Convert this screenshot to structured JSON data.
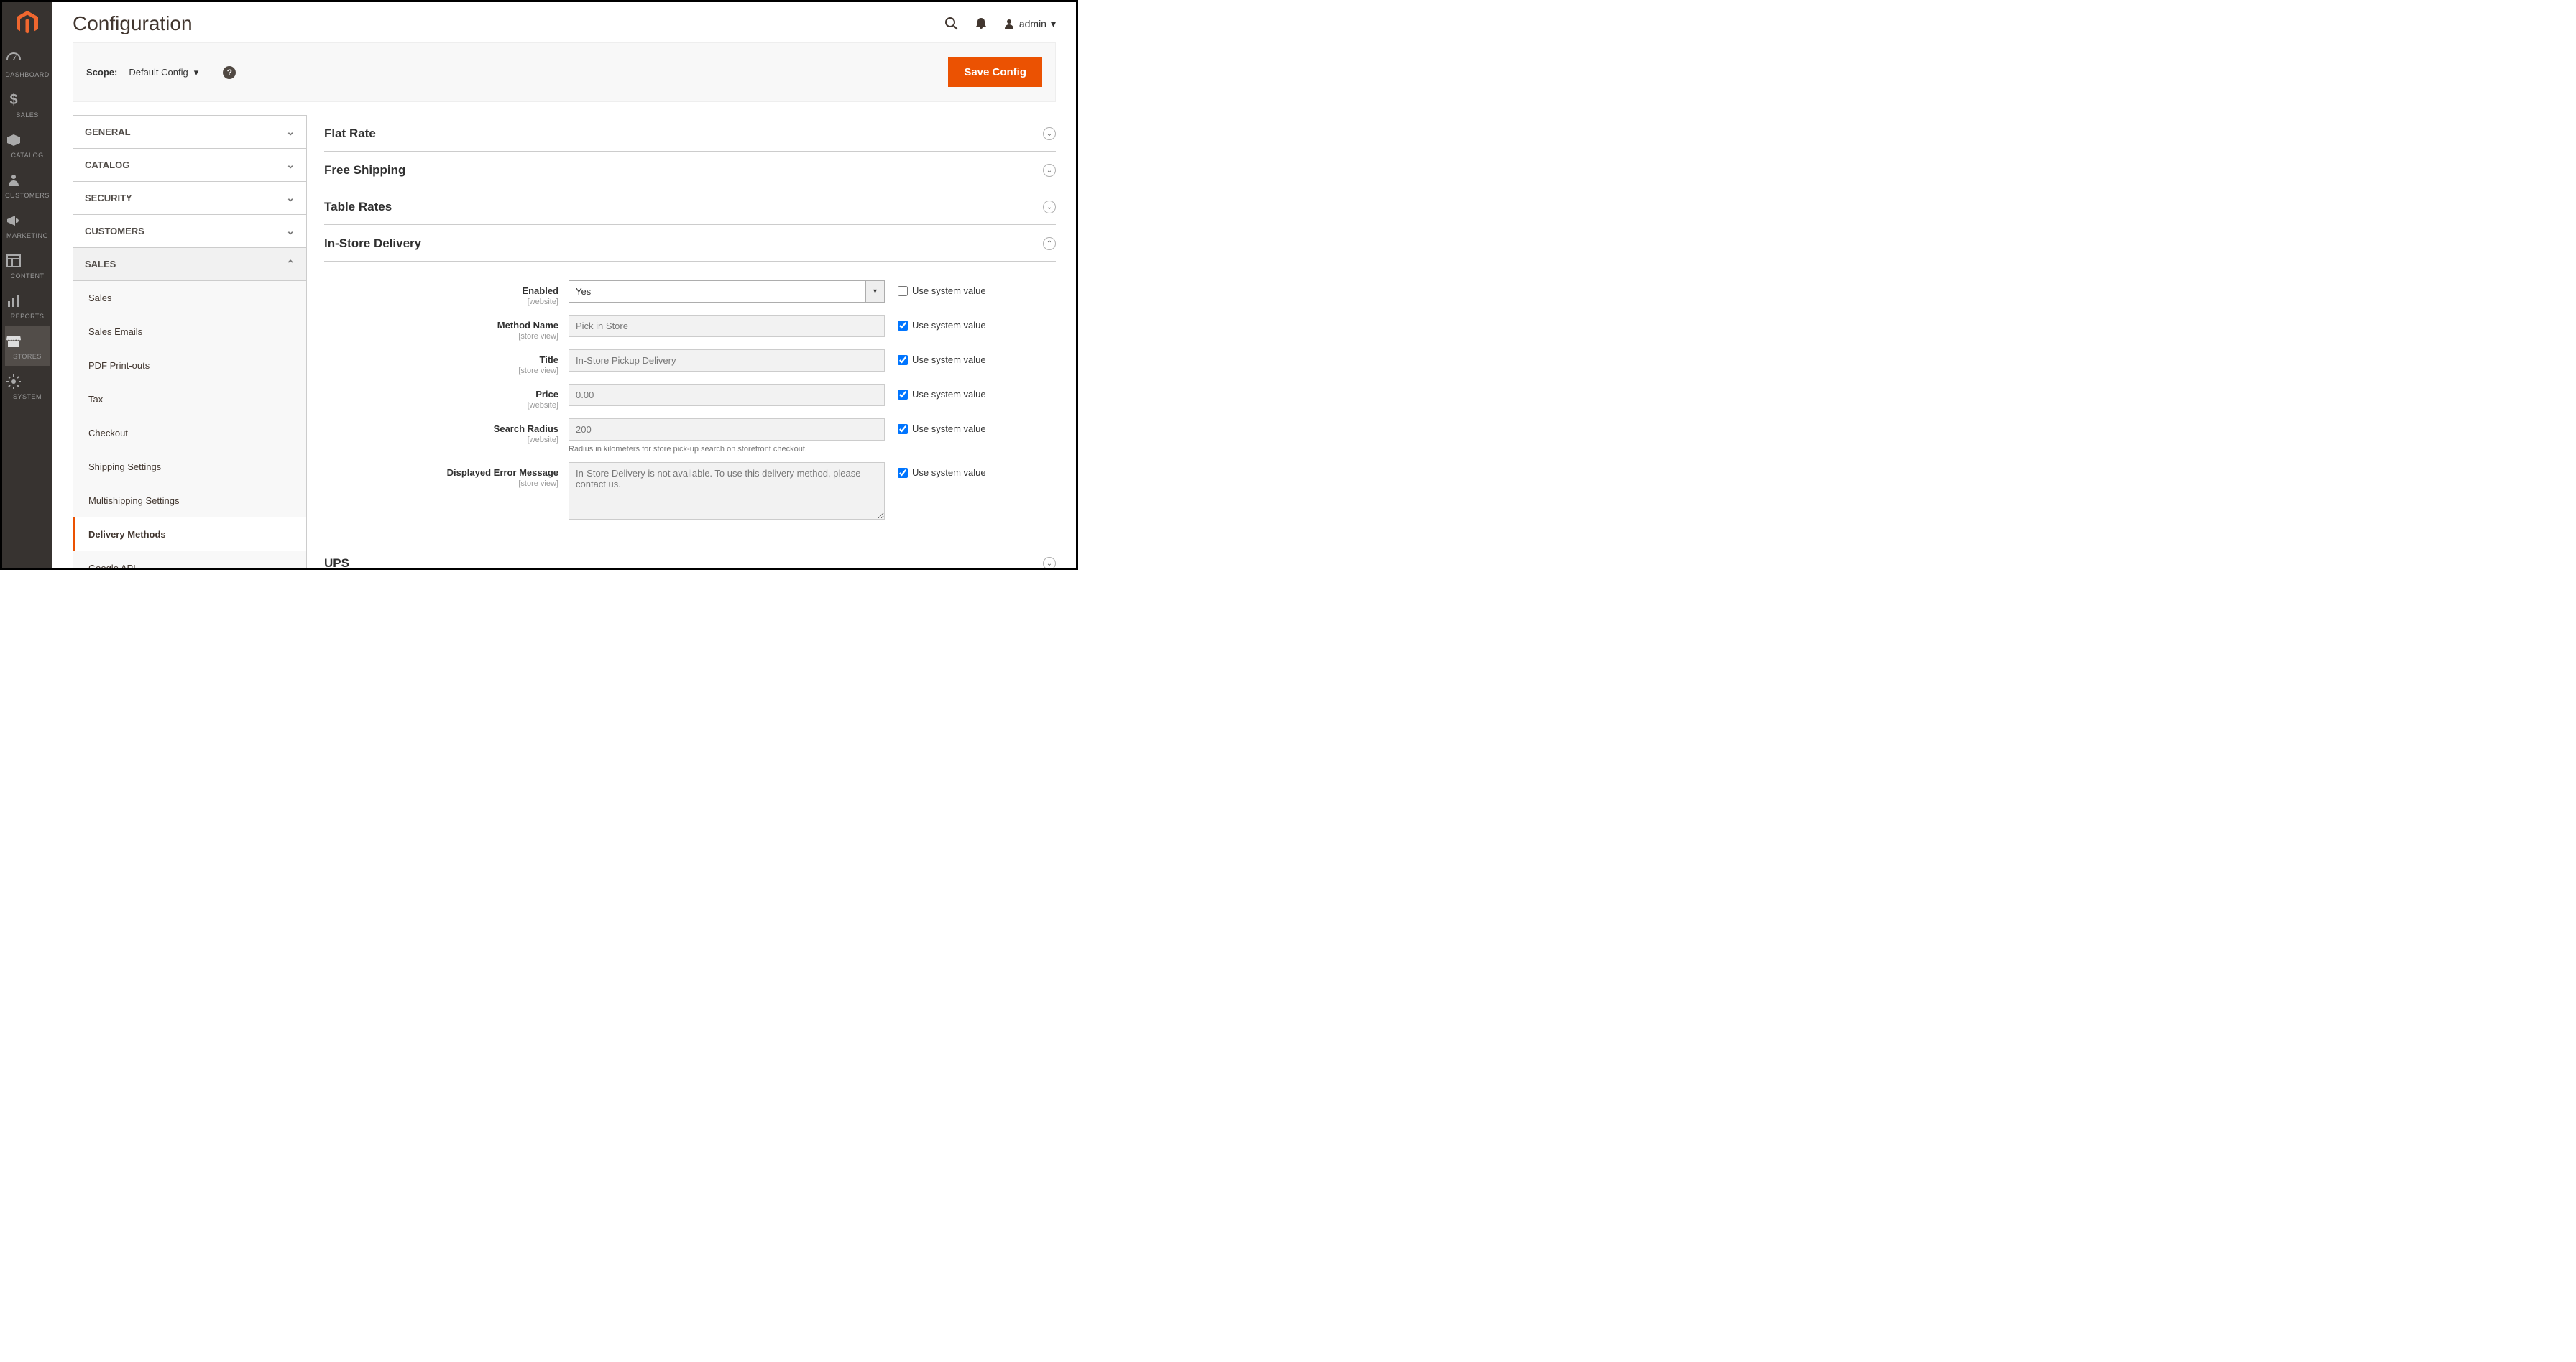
{
  "header": {
    "title": "Configuration",
    "username": "admin"
  },
  "scopebar": {
    "label": "Scope:",
    "value": "Default Config",
    "save": "Save Config"
  },
  "leftnav": [
    {
      "id": "dashboard",
      "label": "DASHBOARD"
    },
    {
      "id": "sales",
      "label": "SALES"
    },
    {
      "id": "catalog",
      "label": "CATALOG"
    },
    {
      "id": "customers",
      "label": "CUSTOMERS"
    },
    {
      "id": "marketing",
      "label": "MARKETING"
    },
    {
      "id": "content",
      "label": "CONTENT"
    },
    {
      "id": "reports",
      "label": "REPORTS"
    },
    {
      "id": "stores",
      "label": "STORES"
    },
    {
      "id": "system",
      "label": "SYSTEM"
    }
  ],
  "tabs": [
    {
      "label": "GENERAL",
      "open": false
    },
    {
      "label": "CATALOG",
      "open": false
    },
    {
      "label": "SECURITY",
      "open": false
    },
    {
      "label": "CUSTOMERS",
      "open": false
    },
    {
      "label": "SALES",
      "open": true,
      "items": [
        "Sales",
        "Sales Emails",
        "PDF Print-outs",
        "Tax",
        "Checkout",
        "Shipping Settings",
        "Multishipping Settings",
        "Delivery Methods",
        "Google API"
      ],
      "active": "Delivery Methods"
    }
  ],
  "sections": {
    "flat_rate": "Flat Rate",
    "free_shipping": "Free Shipping",
    "table_rates": "Table Rates",
    "instore": "In-Store Delivery",
    "ups": "UPS"
  },
  "instore_fields": {
    "enabled": {
      "label": "Enabled",
      "scope": "[website]",
      "value": "Yes",
      "system": false
    },
    "method_name": {
      "label": "Method Name",
      "scope": "[store view]",
      "value": "Pick in Store",
      "system": true
    },
    "title_f": {
      "label": "Title",
      "scope": "[store view]",
      "value": "In-Store Pickup Delivery",
      "system": true
    },
    "price": {
      "label": "Price",
      "scope": "[website]",
      "value": "0.00",
      "system": true
    },
    "search_radius": {
      "label": "Search Radius",
      "scope": "[website]",
      "value": "200",
      "system": true,
      "note": "Radius in kilometers for store pick-up search on storefront checkout."
    },
    "error_msg": {
      "label": "Displayed Error Message",
      "scope": "[store view]",
      "value": "In-Store Delivery is not available. To use this delivery method, please contact us.",
      "system": true
    }
  },
  "system_value_label": "Use system value"
}
